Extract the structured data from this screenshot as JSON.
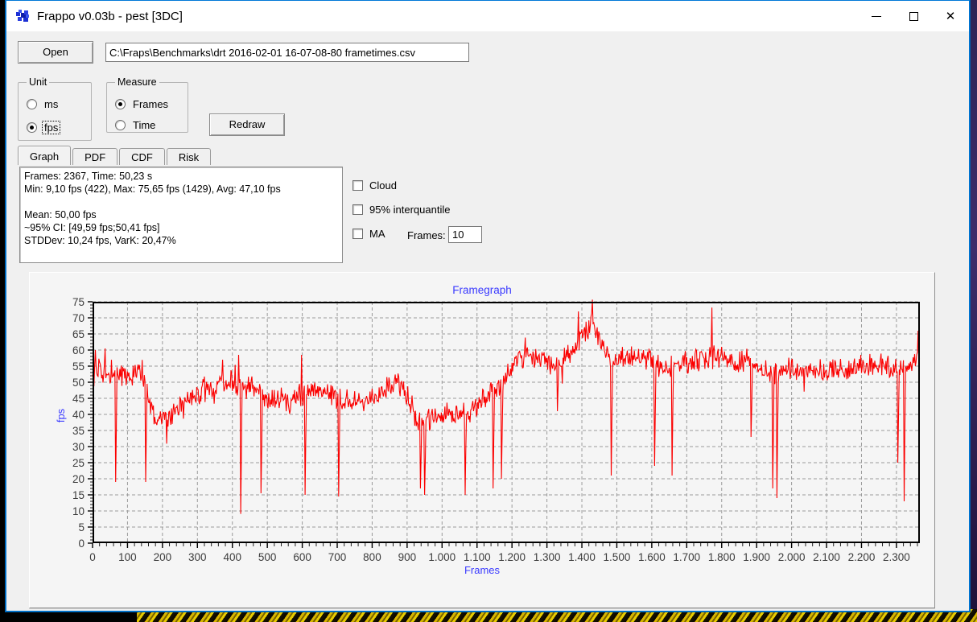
{
  "window": {
    "title": "Frappo v0.03b - pest [3DC]",
    "controls": {
      "minimize": "minimize",
      "maximize": "maximize",
      "close": "close"
    }
  },
  "toolbar": {
    "open_label": "Open",
    "file_path": "C:\\Fraps\\Benchmarks\\drt 2016-02-01 16-07-08-80 frametimes.csv"
  },
  "unit_group": {
    "label": "Unit",
    "options": [
      {
        "label": "ms",
        "selected": false
      },
      {
        "label": "fps",
        "selected": true,
        "focused": true
      }
    ]
  },
  "measure_group": {
    "label": "Measure",
    "options": [
      {
        "label": "Frames",
        "selected": true
      },
      {
        "label": "Time",
        "selected": false
      }
    ]
  },
  "redraw_label": "Redraw",
  "tabs": {
    "items": [
      "Graph",
      "PDF",
      "CDF",
      "Risk"
    ],
    "active": "Graph"
  },
  "stats": {
    "lines": [
      "Frames: 2367, Time: 50,23 s",
      "Min: 9,10 fps (422), Max: 75,65 fps (1429), Avg: 47,10 fps",
      "",
      "Mean: 50,00 fps",
      "~95% CI: [49,59 fps;50,41 fps]",
      "STDDev: 10,24 fps, VarK: 20,47%"
    ]
  },
  "options": {
    "cloud": {
      "label": "Cloud",
      "checked": false
    },
    "interquantile": {
      "label": "95% interquantile",
      "checked": false
    },
    "ma": {
      "label": "MA",
      "checked": false
    },
    "frames_label": "Frames:",
    "frames_value": "10"
  },
  "chart_data": {
    "type": "line",
    "title": "Framegraph",
    "xlabel": "Frames",
    "ylabel": "fps",
    "xlim": [
      0,
      2367
    ],
    "ylim": [
      0,
      75
    ],
    "grid": "dashed",
    "line_color": "#fb0000",
    "x_tick_labels": [
      "0",
      "100",
      "200",
      "300",
      "400",
      "500",
      "600",
      "700",
      "800",
      "900",
      "1.000",
      "1.100",
      "1.200",
      "1.300",
      "1.400",
      "1.500",
      "1.600",
      "1.700",
      "1.800",
      "1.900",
      "2.000",
      "2.100",
      "2.200",
      "2.300"
    ],
    "x_tick_step": 100,
    "y_tick_labels": [
      "0",
      "5",
      "10",
      "15",
      "20",
      "25",
      "30",
      "35",
      "40",
      "45",
      "50",
      "55",
      "60",
      "65",
      "70",
      "75"
    ],
    "y_tick_step": 5,
    "noise_amplitude": 4,
    "baseline_points": [
      [
        0,
        50
      ],
      [
        15,
        55
      ],
      [
        40,
        53
      ],
      [
        70,
        52
      ],
      [
        100,
        52
      ],
      [
        130,
        53
      ],
      [
        150,
        52
      ],
      [
        165,
        44
      ],
      [
        180,
        39
      ],
      [
        210,
        38
      ],
      [
        235,
        40
      ],
      [
        255,
        44
      ],
      [
        285,
        45
      ],
      [
        320,
        47
      ],
      [
        355,
        48
      ],
      [
        390,
        50
      ],
      [
        415,
        49
      ],
      [
        445,
        49
      ],
      [
        470,
        48
      ],
      [
        495,
        44
      ],
      [
        520,
        45
      ],
      [
        545,
        44
      ],
      [
        575,
        45
      ],
      [
        600,
        46
      ],
      [
        630,
        48
      ],
      [
        660,
        47
      ],
      [
        690,
        46
      ],
      [
        720,
        44
      ],
      [
        750,
        44
      ],
      [
        780,
        44
      ],
      [
        810,
        45
      ],
      [
        840,
        48
      ],
      [
        865,
        50
      ],
      [
        885,
        49
      ],
      [
        905,
        44
      ],
      [
        925,
        39
      ],
      [
        945,
        37
      ],
      [
        965,
        39
      ],
      [
        1000,
        40
      ],
      [
        1040,
        40
      ],
      [
        1075,
        41
      ],
      [
        1105,
        43
      ],
      [
        1135,
        46
      ],
      [
        1165,
        49
      ],
      [
        1185,
        52
      ],
      [
        1205,
        56
      ],
      [
        1235,
        58
      ],
      [
        1265,
        58
      ],
      [
        1295,
        57
      ],
      [
        1320,
        55
      ],
      [
        1345,
        57
      ],
      [
        1375,
        60
      ],
      [
        1400,
        63
      ],
      [
        1415,
        66
      ],
      [
        1430,
        69
      ],
      [
        1445,
        64
      ],
      [
        1465,
        59
      ],
      [
        1485,
        56
      ],
      [
        1505,
        57
      ],
      [
        1530,
        58
      ],
      [
        1560,
        58
      ],
      [
        1590,
        57
      ],
      [
        1620,
        55
      ],
      [
        1650,
        55
      ],
      [
        1685,
        56
      ],
      [
        1715,
        57
      ],
      [
        1745,
        57
      ],
      [
        1775,
        58
      ],
      [
        1805,
        58
      ],
      [
        1835,
        56
      ],
      [
        1865,
        57
      ],
      [
        1895,
        55
      ],
      [
        1920,
        54
      ],
      [
        1945,
        54
      ],
      [
        1970,
        53
      ],
      [
        2000,
        54
      ],
      [
        2035,
        53
      ],
      [
        2070,
        54
      ],
      [
        2105,
        53
      ],
      [
        2140,
        54
      ],
      [
        2175,
        54
      ],
      [
        2210,
        55
      ],
      [
        2245,
        56
      ],
      [
        2275,
        55
      ],
      [
        2305,
        54
      ],
      [
        2335,
        56
      ],
      [
        2367,
        57
      ]
    ],
    "dips": [
      [
        66,
        19
      ],
      [
        151,
        19
      ],
      [
        424,
        9.1
      ],
      [
        481,
        15.5
      ],
      [
        608,
        15
      ],
      [
        703,
        14.5
      ],
      [
        938,
        17
      ],
      [
        950,
        15
      ],
      [
        1065,
        15
      ],
      [
        1146,
        17
      ],
      [
        1170,
        20
      ],
      [
        1330,
        41
      ],
      [
        1484,
        21
      ],
      [
        1607,
        24
      ],
      [
        1657,
        21
      ],
      [
        1883,
        33
      ],
      [
        1946,
        17
      ],
      [
        1958,
        14
      ],
      [
        2303,
        25
      ],
      [
        2321,
        13
      ]
    ],
    "spikes": [
      [
        8,
        60
      ],
      [
        35,
        60.5
      ],
      [
        371,
        57
      ],
      [
        418,
        58.5
      ],
      [
        598,
        58.5
      ],
      [
        1390,
        72
      ],
      [
        1429,
        75.65
      ],
      [
        1772,
        73.2
      ],
      [
        2361,
        66
      ]
    ],
    "summary": {
      "frames": 2367,
      "time_s": 50.23,
      "min_fps": 9.1,
      "min_frame": 422,
      "max_fps": 75.65,
      "max_frame": 1429,
      "avg_fps": 47.1,
      "mean_fps": 50.0,
      "ci_low": 49.59,
      "ci_high": 50.41,
      "stddev_fps": 10.24,
      "vark_pct": 20.47
    }
  }
}
